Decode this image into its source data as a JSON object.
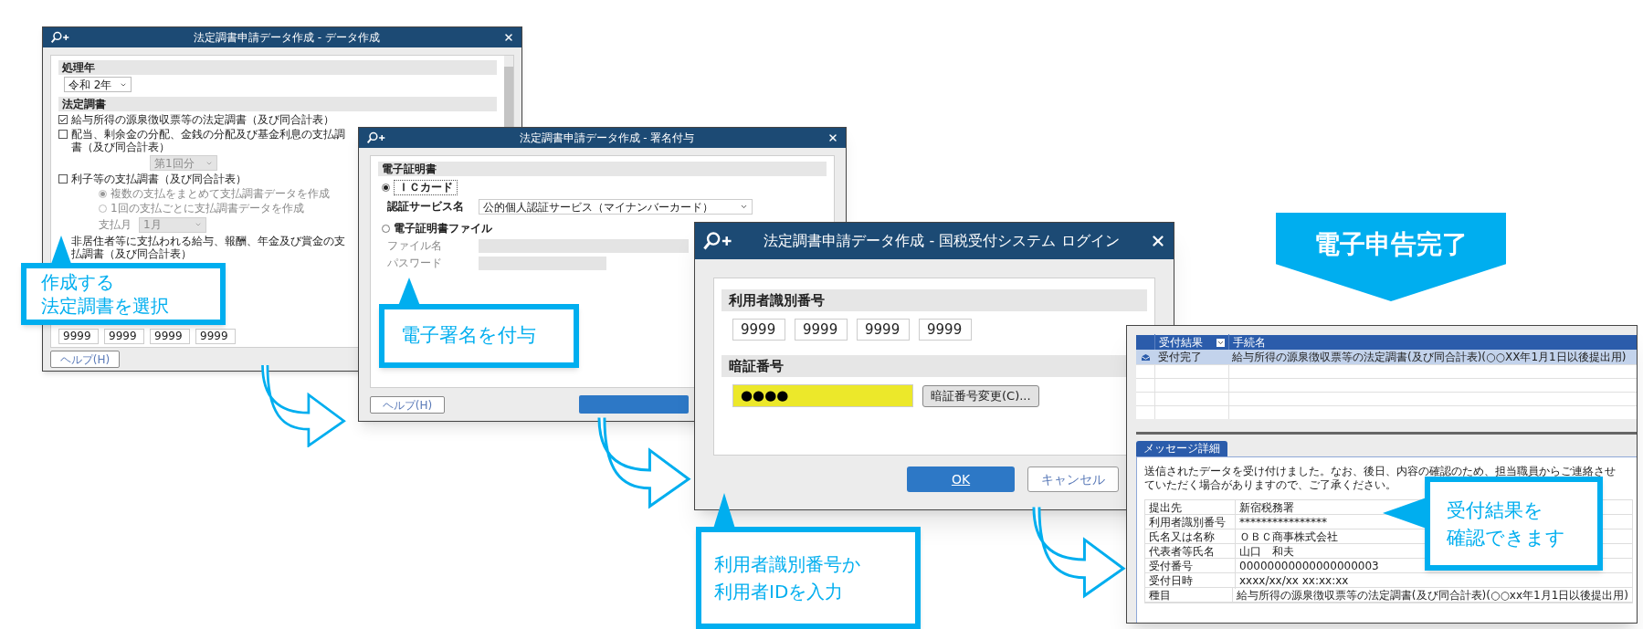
{
  "data_creation_window": {
    "title": "法定調書申請データ作成 - データ作成",
    "sections": [
      {
        "heading": "処理年",
        "items": [
          {
            "kind": "select",
            "value": "令和 2年",
            "disabled": false
          }
        ]
      },
      {
        "heading": "法定調書",
        "items": [
          {
            "kind": "checkbox",
            "label": "給与所得の源泉徴収票等の法定調書（及び同合計表）",
            "checked": true
          },
          {
            "kind": "checkbox",
            "label": "配当、剰余金の分配、金銭の分配及び基金利息の支払調書（及び同合計表）",
            "checked": false
          },
          {
            "kind": "select",
            "value": "第1回分",
            "disabled": true
          },
          {
            "kind": "checkbox",
            "label": "利子等の支払調書（及び同合計表）",
            "checked": false
          },
          {
            "kind": "radio",
            "label": "複数の支払をまとめて支払調書データを作成",
            "selected": true,
            "disabled": true
          },
          {
            "kind": "radio",
            "label": "1回の支払ごとに支払調書データを作成",
            "selected": false,
            "disabled": true
          },
          {
            "kind": "select",
            "label": "支払月",
            "value": "1月",
            "disabled": true
          },
          {
            "kind": "label",
            "label": "非居住者等に支払われる給与、報酬、年金及び賞金の支払調書（及び同合計表）"
          }
        ]
      }
    ],
    "code_fields": [
      "9999",
      "9999",
      "9999",
      "9999"
    ],
    "help_button": "ヘルプ(H)"
  },
  "signature_window": {
    "title": "法定調書申請データ作成 - 署名付与",
    "heading": "電子証明書",
    "options": [
      {
        "label": "ＩＣカード",
        "selected": true,
        "fields": [
          {
            "label": "認証サービス名",
            "value": "公的個人認証サービス（マイナンバーカード）",
            "disabled": false
          }
        ]
      },
      {
        "label": "電子証明書ファイル",
        "selected": false,
        "fields": [
          {
            "label": "ファイル名",
            "disabled": true
          },
          {
            "label": "パスワード",
            "disabled": true
          }
        ]
      }
    ],
    "help_button": "ヘルプ(H)"
  },
  "login_window": {
    "title": "法定調書申請データ作成 - 国税受付システム ログイン",
    "user_id_heading": "利用者識別番号",
    "user_id_fields": [
      "9999",
      "9999",
      "9999",
      "9999"
    ],
    "pin_heading": "暗証番号",
    "pin_value": "●●●●",
    "change_pin_button": "暗証番号変更(C)...",
    "ok_button": "OK",
    "cancel_button": "キャンセル"
  },
  "result_window": {
    "columns": [
      "受付結果",
      "手続名"
    ],
    "rows": [
      {
        "result": "受付完了",
        "procedure": "給与所得の源泉徴収票等の法定調書(及び同合計表)(○○XX年1月1日以後提出用)",
        "selected": true
      }
    ],
    "tab": "メッセージ詳細",
    "message": "送信されたデータを受け付けました。なお、後日、内容の確認のため、担当職員からご連絡させていただく場合がありますので、ご了承ください。",
    "details": [
      {
        "label": "提出先",
        "value": "新宿税務署"
      },
      {
        "label": "利用者識別番号",
        "value": "****************"
      },
      {
        "label": "氏名又は名称",
        "value": "ＯＢＣ商事株式会社"
      },
      {
        "label": "代表者等氏名",
        "value": "山口　和夫"
      },
      {
        "label": "受付番号",
        "value": "00000000000000000003"
      },
      {
        "label": "受付日時",
        "value": "xxxx/xx/xx xx:xx:xx"
      },
      {
        "label": "種目",
        "value": "給与所得の源泉徴収票等の法定調書(及び同合計表)(○○xx年1月1日以後提出用)"
      }
    ]
  },
  "banner": "電子申告完了",
  "callouts": [
    {
      "lines": [
        "作成する",
        "法定調書を選択"
      ]
    },
    {
      "lines": [
        "電子署名を付与"
      ]
    },
    {
      "lines": [
        "利用者識別番号か",
        "利用者IDを入力"
      ]
    },
    {
      "lines": [
        "受付結果を",
        "確認できます"
      ]
    }
  ]
}
